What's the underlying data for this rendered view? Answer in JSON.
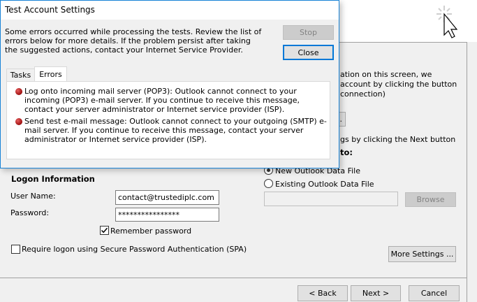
{
  "dialog": {
    "title": "Test Account Settings",
    "message": "Some errors occurred while processing the tests. Review the list of errors below for more details. If the problem persist after taking the suggested actions, contact your Internet Service Provider.",
    "stop_label": "Stop",
    "close_label": "Close",
    "tabs": [
      {
        "label": "Tasks"
      },
      {
        "label": "Errors"
      }
    ],
    "errors": [
      {
        "text": "Log onto incoming mail server (POP3): Outlook cannot connect to your incoming (POP3) e-mail server. If you continue to receive this message, contact your server administrator or Internet service provider (ISP)."
      },
      {
        "text": "Send test e-mail message: Outlook cannot connect to your outgoing (SMTP) e-mail server. If you continue to receive this message, contact your server administrator or Internet service provider (ISP)."
      }
    ]
  },
  "background": {
    "partial_text_1": "ation on this screen, we",
    "partial_text_2": "account by clicking the button",
    "partial_text_3": "connection)",
    "partial_text_4": "gs by clicking the Next button",
    "partial_text_5": "to:",
    "partial_button_label": "..."
  },
  "logon": {
    "section_title": "Logon Information",
    "user_name_label": "User Name:",
    "user_name_value": "contact@trustediplc.com",
    "password_label": "Password:",
    "password_value": "****************",
    "remember_label": "Remember password",
    "remember_checked": true,
    "spa_label": "Require logon using Secure Password Authentication (SPA)",
    "spa_checked": false
  },
  "deliver": {
    "new_file_label": "New Outlook Data File",
    "existing_file_label": "Existing Outlook Data File",
    "existing_path_value": "",
    "browse_label": "Browse"
  },
  "more_settings_label": "More Settings ...",
  "footer": {
    "back_label": "< Back",
    "next_label": "Next >",
    "cancel_label": "Cancel"
  },
  "icons": {
    "cursor": "busy-cursor-icon",
    "error": "error-icon"
  },
  "colors": {
    "dialog_border": "#1883d7",
    "window_bg": "#f0f0f0",
    "error_red": "#9b0c0c"
  }
}
